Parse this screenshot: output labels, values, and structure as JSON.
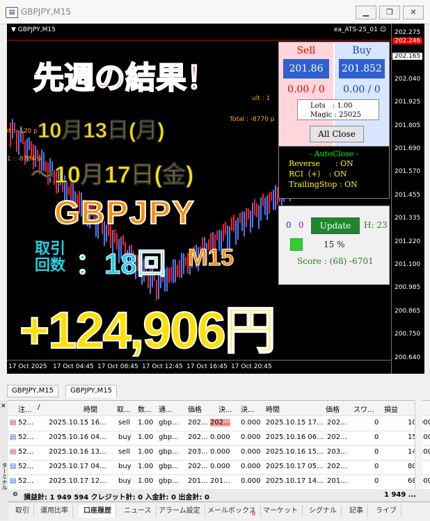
{
  "window": {
    "title": "GBPJPY,M15",
    "min": "▁",
    "restore": "❐",
    "close": "✕"
  },
  "chart": {
    "symbol": "▼ GBPJPY,M15",
    "ea_name": "ea_ATS-25_01 ☺",
    "y_ticks": [
      "202.275",
      "202.165",
      "202.040",
      "201.925",
      "201.805",
      "201.690",
      "201.570",
      "201.455",
      "201.335",
      "201.220",
      "201.100",
      "200.985",
      "200.865",
      "200.750",
      "200.640"
    ],
    "red_price": "202.246",
    "white_price": "202.165",
    "x_ticks": [
      "17 Oct 2025",
      "17 Oct 04:45",
      "17 Oct 08:45",
      "17 Oct 12:45",
      "17 Oct 16:45",
      "17 Oct 20:45"
    ],
    "bg_labels": {
      "profit_a": "it : -120 p",
      "profit_b": "1 : -8784 p",
      "total": "Total : -8770 p",
      "ult": "ult : 1"
    }
  },
  "panel": {
    "sell_label": "Sell",
    "buy_label": "Buy",
    "sell_price": "201.86",
    "buy_price": "201.852",
    "sell_pl": "0.00 / 0",
    "buy_pl": "0.00 / 0",
    "lots": "Lots　: 1.00",
    "magic": "Magic : 25025",
    "all_close": "All Close",
    "autoclose_title": "- AutoClose -",
    "autoclose_rows": [
      "Reverse　　: ON",
      "RCI（+）　: ON",
      "TrailingStop : ON"
    ],
    "update_counts": [
      "0",
      "0"
    ],
    "update_label": "Update",
    "update_h": "H: 23",
    "percent": "15 %",
    "score": "Score : (68) -6701"
  },
  "overlay": {
    "title": "先週の結果！",
    "date1": "10月13日(月)",
    "date2": "～10月17日(金)",
    "pair": "GBPJPY",
    "count_label_1": "取引",
    "count_label_2": "回数",
    "count_value": "：18回",
    "timeframe": "M15",
    "result": "+124,906円"
  },
  "chart_tabs": [
    "GBPJPY,M15",
    "GBPJPY,M15"
  ],
  "terminal": {
    "headers": [
      "注...",
      "/",
      "時間",
      "取...",
      "数...",
      "通...",
      "価格",
      "決...",
      "決...",
      "時間",
      "価格",
      "スワ...",
      "損益"
    ],
    "rows": [
      [
        "52...",
        "2025.10.15 16...",
        "sell",
        "1.00",
        "gbp...",
        "202...",
        "202...",
        "0.000",
        "2025.10.15 17...",
        "202...",
        "0",
        "10 000"
      ],
      [
        "52...",
        "2025.10.16 04...",
        "buy",
        "1.00",
        "gbp...",
        "202...",
        "0.000",
        "0.000",
        "2025.10.16 06...",
        "202...",
        "0",
        "15 400"
      ],
      [
        "52...",
        "2025.10.16 13...",
        "sell",
        "1.00",
        "gbp...",
        "203...",
        "0.000",
        "0.000",
        "2025.10.16 15...",
        "203...",
        "0",
        "14 300"
      ],
      [
        "52...",
        "2025.10.17 04...",
        "buy",
        "1.00",
        "gbp...",
        "202...",
        "0.000",
        "0.000",
        "2025.10.17 05...",
        "202...",
        "0",
        "800"
      ],
      [
        "52...",
        "2025.10.17 12...",
        "buy",
        "1.00",
        "gbp...",
        "201...",
        "201...",
        "0.000",
        "2025.10.17 14...",
        "201...",
        "0",
        "68 500"
      ]
    ],
    "summary": "損益計: 1 949 594  クレジット計: 0  入金計: 0  出金計: 0",
    "summary_right": "1 949 ...",
    "bottom_tabs": [
      "取引",
      "運用比率",
      "口座履歴",
      "ニュース",
      "アラーム設定",
      "メールボックス",
      "マーケット",
      "シグナル",
      "記事",
      "ライブ"
    ],
    "mail_badge": "6",
    "side_label": "ターミナル"
  }
}
